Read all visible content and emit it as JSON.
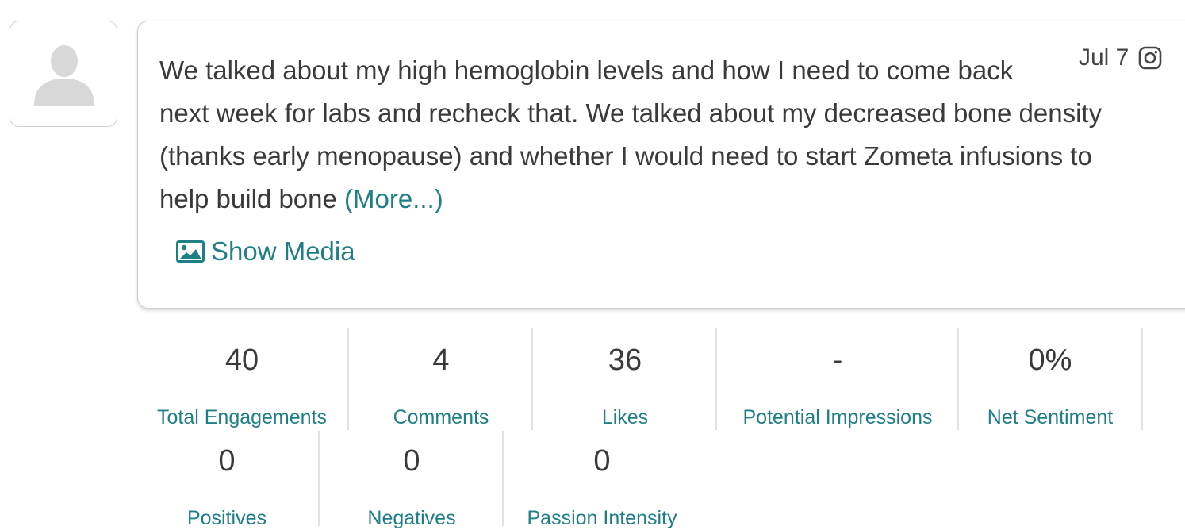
{
  "post": {
    "date": "Jul 7",
    "platform_icon": "instagram-icon",
    "text_lines": [
      "We talked about my high hemoglobin levels and how I need to come back",
      "next week for labs and recheck that. We talked about my decreased bone density",
      "(thanks early menopause) and whether I would need to start Zometa infusions to",
      "help build bone"
    ],
    "more_label": "(More...)",
    "show_media_label": "Show Media"
  },
  "stats_row1": [
    {
      "value": "40",
      "label": "Total Engagements"
    },
    {
      "value": "4",
      "label": "Comments"
    },
    {
      "value": "36",
      "label": "Likes"
    },
    {
      "value": "-",
      "label": "Potential Impressions"
    },
    {
      "value": "0%",
      "label": "Net Sentiment"
    }
  ],
  "stats_row2": [
    {
      "value": "0",
      "label": "Positives"
    },
    {
      "value": "0",
      "label": "Negatives"
    },
    {
      "value": "0",
      "label": "Passion Intensity"
    }
  ],
  "colors": {
    "accent": "#1f7f86",
    "text": "#3a3a3a",
    "border": "#cfcfcf"
  }
}
